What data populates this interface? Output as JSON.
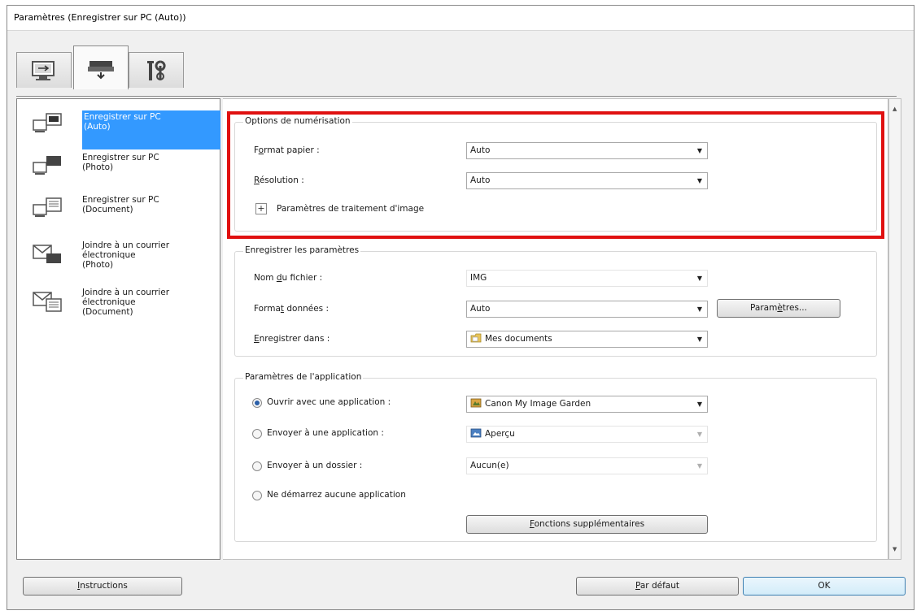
{
  "window": {
    "title": "Paramètres (Enregistrer sur PC (Auto))"
  },
  "tabs": [
    {
      "icon": "computer-scan-icon"
    },
    {
      "icon": "scanner-icon"
    },
    {
      "icon": "tools-icon"
    }
  ],
  "sidebar": {
    "items": [
      {
        "label": "Enregistrer sur PC\n(Auto)",
        "icon": "save-pc-auto-icon"
      },
      {
        "label": "Enregistrer sur PC\n(Photo)",
        "icon": "save-pc-photo-icon"
      },
      {
        "label": "Enregistrer sur PC\n(Document)",
        "icon": "save-pc-document-icon"
      },
      {
        "label": "Joindre à un courrier\nélectronique\n(Photo)",
        "icon": "email-photo-icon"
      },
      {
        "label": "Joindre à un courrier\nélectronique\n(Document)",
        "icon": "email-document-icon"
      }
    ]
  },
  "scan_options": {
    "title": "Options de numérisation",
    "paper_size_label_pre": "F",
    "paper_size_label_u": "o",
    "paper_size_label_post": "rmat papier :",
    "paper_size_value": "Auto",
    "resolution_label_u": "R",
    "resolution_label_post": "ésolution :",
    "resolution_value": "Auto",
    "image_processing_label": "Paramètres de traitement d'image",
    "expand_symbol": "+"
  },
  "save_settings": {
    "title": "Enregistrer les paramètres",
    "file_name_label_pre": "Nom ",
    "file_name_label_u": "d",
    "file_name_label_post": "u fichier :",
    "file_name_value": "IMG",
    "data_format_label_pre": "Forma",
    "data_format_label_u": "t",
    "data_format_label_post": " données :",
    "data_format_value": "Auto",
    "settings_button_pre": "Param",
    "settings_button_u": "è",
    "settings_button_post": "tres...",
    "save_in_label_u": "E",
    "save_in_label_post": "nregistrer dans :",
    "save_in_value": "Mes documents"
  },
  "app_settings": {
    "title": "Paramètres de l'application",
    "open_with_app_label": "Ouvrir avec une application :",
    "open_with_app_value": "Canon My Image Garden",
    "send_to_app_label": "Envoyer à une application :",
    "send_to_app_value": "Aperçu",
    "send_to_folder_label": "Envoyer à un dossier :",
    "send_to_folder_value": "Aucun(e)",
    "no_app_label": "Ne démarrez aucune application",
    "more_functions_u": "F",
    "more_functions_post": "onctions supplémentaires"
  },
  "footer": {
    "instructions_u": "I",
    "instructions_post": "nstructions",
    "defaults_u": "P",
    "defaults_post": "ar défaut",
    "ok_label": "OK"
  },
  "colors": {
    "highlight": "#e01010",
    "selection": "#3399ff"
  }
}
